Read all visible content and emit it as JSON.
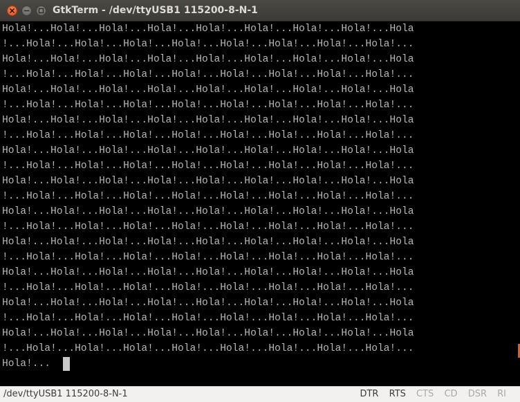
{
  "window": {
    "title": "GtkTerm - /dev/ttyUSB1  115200-8-N-1"
  },
  "terminal": {
    "lines": [
      "Hola!...Hola!...Hola!...Hola!...Hola!...Hola!...Hola!...Hola!...Hola",
      "!...Hola!...Hola!...Hola!...Hola!...Hola!...Hola!...Hola!...Hola!...",
      "Hola!...Hola!...Hola!...Hola!...Hola!...Hola!...Hola!...Hola!...Hola",
      "!...Hola!...Hola!...Hola!...Hola!...Hola!...Hola!...Hola!...Hola!...",
      "Hola!...Hola!...Hola!...Hola!...Hola!...Hola!...Hola!...Hola!...Hola",
      "!...Hola!...Hola!...Hola!...Hola!...Hola!...Hola!...Hola!...Hola!...",
      "Hola!...Hola!...Hola!...Hola!...Hola!...Hola!...Hola!...Hola!...Hola",
      "!...Hola!...Hola!...Hola!...Hola!...Hola!...Hola!...Hola!...Hola!...",
      "Hola!...Hola!...Hola!...Hola!...Hola!...Hola!...Hola!...Hola!...Hola",
      "!...Hola!...Hola!...Hola!...Hola!...Hola!...Hola!...Hola!...Hola!...",
      "Hola!...Hola!...Hola!...Hola!...Hola!...Hola!...Hola!...Hola!...Hola",
      "!...Hola!...Hola!...Hola!...Hola!...Hola!...Hola!...Hola!...Hola!...",
      "Hola!...Hola!...Hola!...Hola!...Hola!...Hola!...Hola!...Hola!...Hola",
      "!...Hola!...Hola!...Hola!...Hola!...Hola!...Hola!...Hola!...Hola!...",
      "Hola!...Hola!...Hola!...Hola!...Hola!...Hola!...Hola!...Hola!...Hola",
      "!...Hola!...Hola!...Hola!...Hola!...Hola!...Hola!...Hola!...Hola!...",
      "Hola!...Hola!...Hola!...Hola!...Hola!...Hola!...Hola!...Hola!...Hola",
      "!...Hola!...Hola!...Hola!...Hola!...Hola!...Hola!...Hola!...Hola!...",
      "Hola!...Hola!...Hola!...Hola!...Hola!...Hola!...Hola!...Hola!...Hola",
      "!...Hola!...Hola!...Hola!...Hola!...Hola!...Hola!...Hola!...Hola!...",
      "Hola!...Hola!...Hola!...Hola!...Hola!...Hola!...Hola!...Hola!...Hola",
      "!...Hola!...Hola!...Hola!...Hola!...Hola!...Hola!...Hola!...Hola!...",
      "Hola!..."
    ]
  },
  "statusbar": {
    "port_info": "/dev/ttyUSB1  115200-8-N-1",
    "signals": {
      "dtr": "DTR",
      "rts": "RTS",
      "cts": "CTS",
      "cd": "CD",
      "dsr": "DSR",
      "ri": "RI"
    }
  },
  "colors": {
    "terminal_bg": "#000000",
    "terminal_fg": "#b8b8b8",
    "titlebar_bg": "#3c3b37",
    "close_button": "#df4a16",
    "signal_active": "#3c3c3c",
    "signal_inactive": "#a9a9a9"
  },
  "icons": {
    "close": "close-icon",
    "minimize": "minimize-icon",
    "maximize": "maximize-icon"
  }
}
